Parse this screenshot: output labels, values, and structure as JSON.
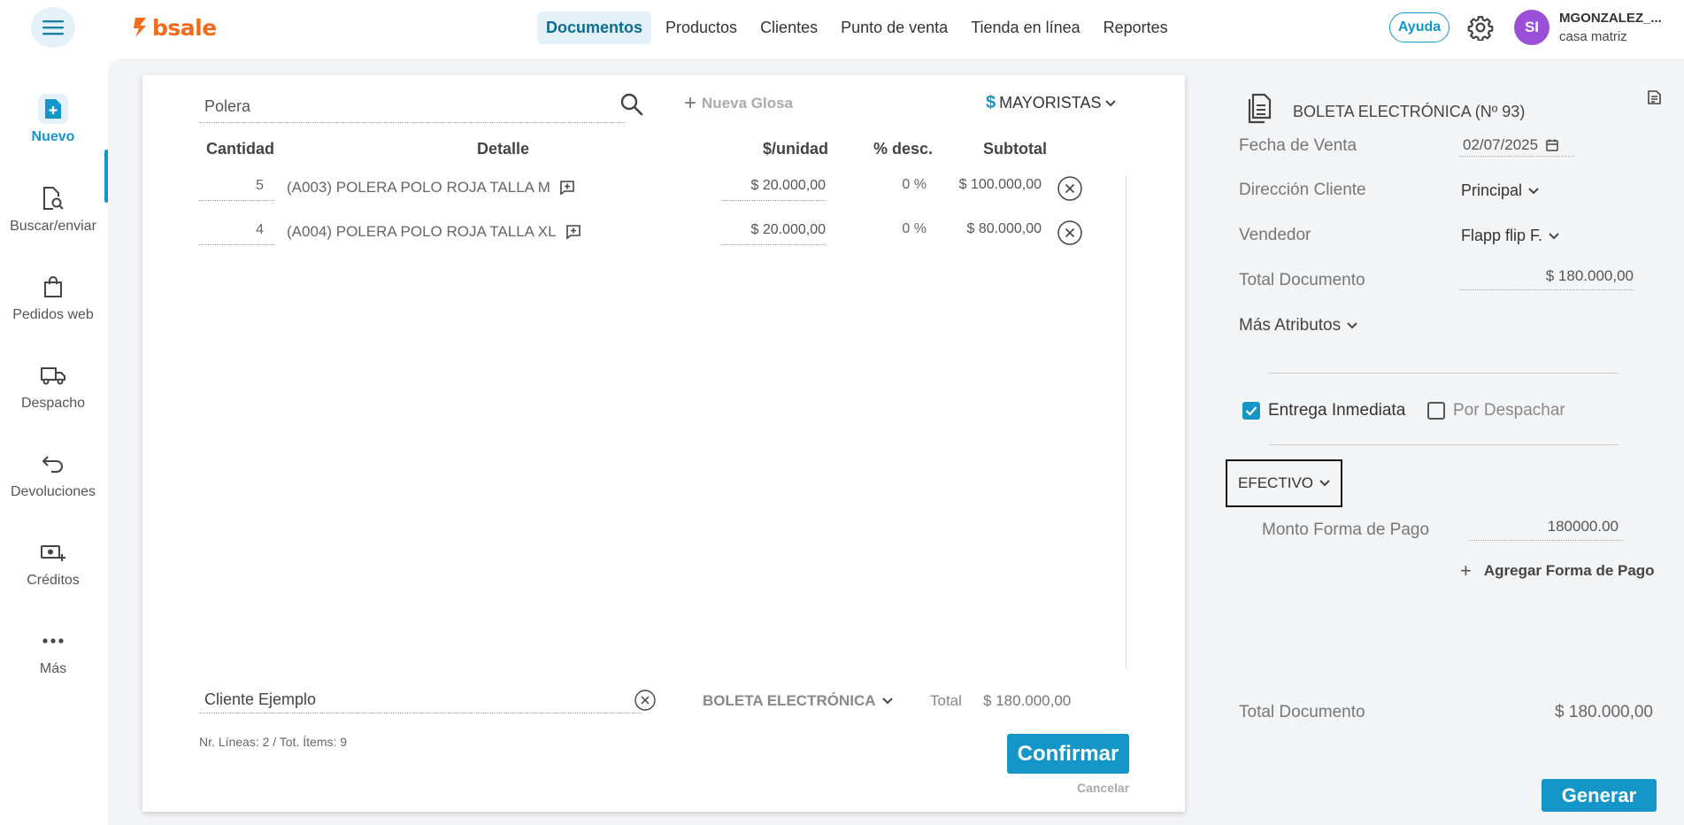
{
  "header": {
    "brand": "bsale",
    "nav": [
      "Documentos",
      "Productos",
      "Clientes",
      "Punto de venta",
      "Tienda en línea",
      "Reportes"
    ],
    "active_nav": "Documentos",
    "help_label": "Ayuda",
    "avatar_initials": "SI",
    "user_name": "MGONZALEZ_...",
    "branch": "casa matriz"
  },
  "sidebar": {
    "items": [
      {
        "label": "Nuevo",
        "icon": "new-document-icon",
        "active": true
      },
      {
        "label": "Buscar/enviar",
        "icon": "search-document-icon"
      },
      {
        "label": "Pedidos web",
        "icon": "shopping-bag-icon"
      },
      {
        "label": "Despacho",
        "icon": "truck-icon"
      },
      {
        "label": "Devoluciones",
        "icon": "return-arrow-icon"
      },
      {
        "label": "Créditos",
        "icon": "cash-plus-icon"
      },
      {
        "label": "Más",
        "icon": "more-dots-icon"
      }
    ]
  },
  "document": {
    "search_value": "Polera",
    "nueva_glosa_label": "Nueva Glosa",
    "price_list_symbol": "$",
    "price_list": "MAYORISTAS",
    "columns": {
      "cantidad": "Cantidad",
      "detalle": "Detalle",
      "unidad": "$/unidad",
      "desc": "% desc.",
      "subtotal": "Subtotal"
    },
    "rows": [
      {
        "qty": "5",
        "detail": "(A003) POLERA POLO ROJA TALLA M",
        "price": "$ 20.000,00",
        "discount": "0 %",
        "subtotal": "$ 100.000,00"
      },
      {
        "qty": "4",
        "detail": "(A004) POLERA POLO ROJA TALLA XL",
        "price": "$ 20.000,00",
        "discount": "0 %",
        "subtotal": "$ 80.000,00"
      }
    ],
    "client": "Cliente Ejemplo",
    "doc_type": "BOLETA ELECTRÓNICA",
    "total_label": "Total",
    "total_value": "$ 180.000,00",
    "lines_info": "Nr. Líneas: 2 / Tot. Ítems: 9",
    "confirm_label": "Confirmar",
    "cancel_label": "Cancelar"
  },
  "panel": {
    "title": "BOLETA ELECTRÓNICA (Nº 93)",
    "fecha_label": "Fecha de Venta",
    "fecha_value": "02/07/2025",
    "direccion_label": "Dirección Cliente",
    "direccion_value": "Principal",
    "vendedor_label": "Vendedor",
    "vendedor_value": "Flapp flip F.",
    "total_doc_label": "Total Documento",
    "total_doc_value": "$ 180.000,00",
    "mas_atributos_label": "Más Atributos",
    "entrega_label": "Entrega Inmediata",
    "entrega_checked": true,
    "despachar_label": "Por Despachar",
    "despachar_checked": false,
    "payment_method": "EFECTIVO",
    "monto_label": "Monto Forma de Pago",
    "monto_value": "180000.00",
    "add_payment_label": "Agregar Forma de Pago",
    "bottom_total_label": "Total Documento",
    "bottom_total_value": "$ 180.000,00",
    "generar_label": "Generar"
  },
  "colors": {
    "accent": "#1496c8",
    "brand": "#f26a1b",
    "avatar": "#9b4fd8"
  }
}
